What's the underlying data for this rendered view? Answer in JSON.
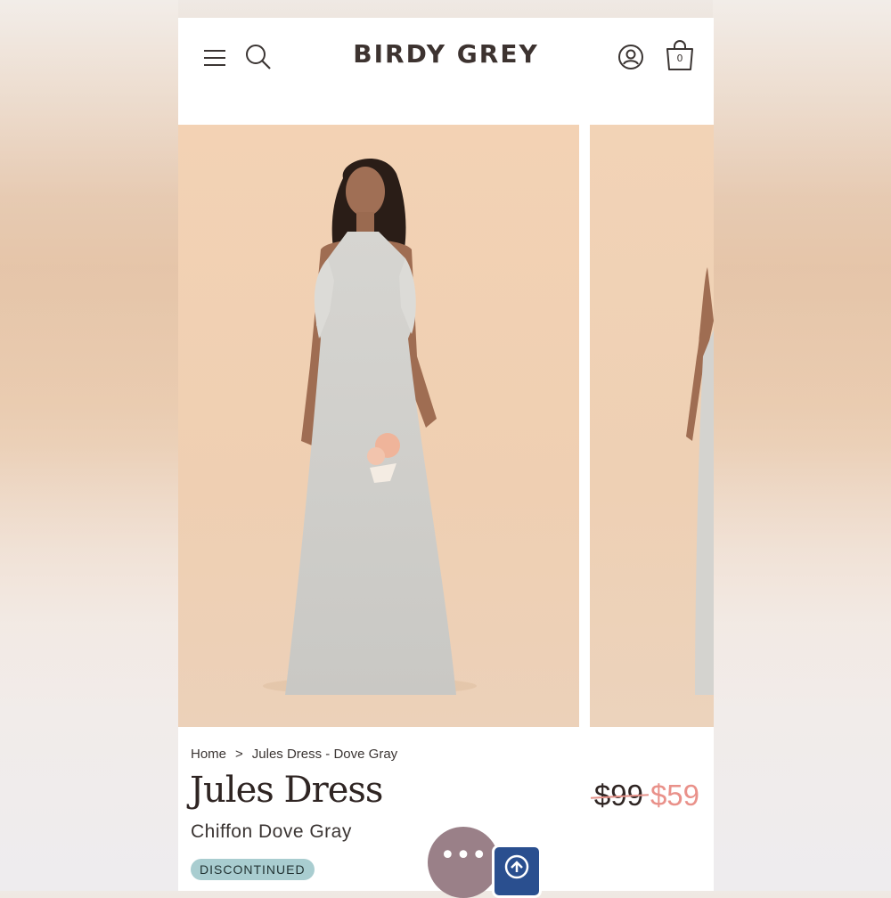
{
  "header": {
    "brand": "BIRDY GREY",
    "cart_count": "0"
  },
  "breadcrumb": {
    "home": "Home",
    "separator": ">",
    "current": "Jules Dress - Dove Gray"
  },
  "product": {
    "title": "Jules Dress",
    "subtitle": "Chiffon Dove Gray",
    "badge": "DISCONTINUED",
    "price_original": "$99",
    "price_sale": "$59"
  },
  "chat": {
    "label": "•••"
  },
  "icons": [
    "menu-icon",
    "search-icon",
    "account-icon",
    "shopping-bag-icon",
    "chat-icon",
    "rewards-icon"
  ],
  "colors": {
    "brand_text": "#3d3330",
    "sale_price": "#e9918a",
    "badge_bg": "#a9cdd0",
    "dress": "#d3d2ce",
    "backdrop": "#f3d2b4"
  }
}
